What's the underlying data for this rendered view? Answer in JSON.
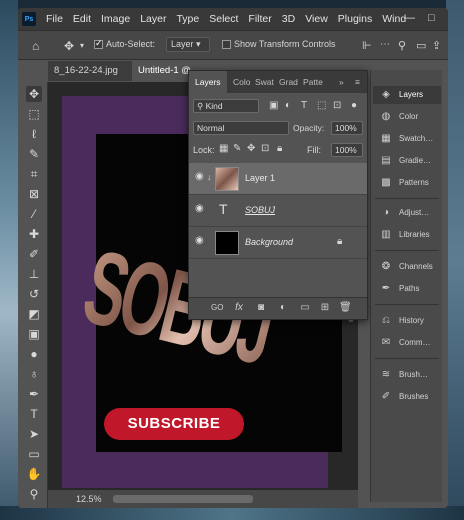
{
  "app": {
    "logo": "Ps",
    "window_controls": [
      "—",
      "□"
    ]
  },
  "menu": [
    "File",
    "Edit",
    "Image",
    "Layer",
    "Type",
    "Select",
    "Filter",
    "3D",
    "View",
    "Plugins",
    "Wind"
  ],
  "options_bar": {
    "auto_select_label": "Auto-Select:",
    "auto_select_value": "Layer",
    "show_transform_label": "Show Transform Controls"
  },
  "doc_tabs": [
    {
      "label": "8_16-22-24.jpg",
      "close": "×"
    },
    {
      "label": "Untitled-1 @",
      "close": ""
    }
  ],
  "canvas": {
    "word": "SOBUJ",
    "button_text": "SUBSCRIBE",
    "zoom": "12.5%"
  },
  "layers_panel": {
    "tabs": [
      "Layers",
      "Colo",
      "Swat",
      "Grad",
      "Patte"
    ],
    "overflow": "»",
    "kind_filter": "Kind",
    "blend_mode": "Normal",
    "opacity_label": "Opacity:",
    "opacity_value": "100%",
    "lock_label": "Lock:",
    "fill_label": "Fill:",
    "fill_value": "100%",
    "layers": [
      {
        "name": "Layer 1",
        "selected": true
      },
      {
        "name": "SOBUJ",
        "type_symbol": "T",
        "selected": false
      },
      {
        "name": "Background",
        "selected": false
      }
    ],
    "bottom_buttons": [
      "GO",
      "fx"
    ]
  },
  "dock": {
    "items": [
      "Layers",
      "Color",
      "Swatch…",
      "Gradie…",
      "Patterns",
      "Adjust…",
      "Libraries",
      "Channels",
      "Paths",
      "History",
      "Comm…",
      "Brush…",
      "Brushes"
    ]
  },
  "colors": {
    "doc_background": "#4b2b5b",
    "subscribe": "#c0172a",
    "ui_panel": "#535353"
  }
}
